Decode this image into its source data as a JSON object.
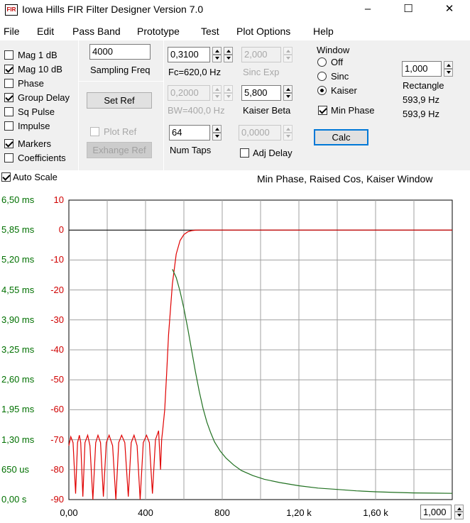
{
  "window": {
    "title": "Iowa Hills FIR Filter Designer  Version 7.0",
    "icon_text": "FIR",
    "controls": {
      "minimize": "–",
      "maximize": "☐",
      "close": "✕"
    }
  },
  "menu": [
    "File",
    "Edit",
    "Pass Band",
    "Prototype",
    "Test",
    "Plot Options",
    "Help"
  ],
  "options": [
    {
      "label": "Mag   1 dB",
      "checked": false
    },
    {
      "label": "Mag 10 dB",
      "checked": true
    },
    {
      "label": "Phase",
      "checked": false
    },
    {
      "label": "Group Delay",
      "checked": true
    },
    {
      "label": "Sq Pulse",
      "checked": false
    },
    {
      "label": "Impulse",
      "checked": false
    },
    {
      "label": "Markers",
      "checked": true
    },
    {
      "label": "Coefficients",
      "checked": false
    }
  ],
  "sampling": {
    "value": "4000",
    "label": "Sampling Freq"
  },
  "set_ref": "Set Ref",
  "plot_ref": {
    "label": "Plot Ref",
    "checked": false
  },
  "exchange_ref": "Exhange Ref",
  "fc": {
    "value": "0,3100",
    "label": "Fc=620,0 Hz"
  },
  "bw": {
    "value": "0,2000",
    "label": "BW=400,0 Hz"
  },
  "num_taps": {
    "value": "64",
    "label": "Num Taps"
  },
  "sinc_exp": {
    "value": "2,000",
    "label": "Sinc Exp"
  },
  "kaiser_beta": {
    "value": "5,800",
    "label": "Kaiser Beta"
  },
  "adj_delay": {
    "value": "0,0000",
    "label": "Adj Delay",
    "checked": false
  },
  "window_group": {
    "title": "Window",
    "options": [
      {
        "label": "Off",
        "selected": false
      },
      {
        "label": "Sinc",
        "selected": false
      },
      {
        "label": "Kaiser",
        "selected": true
      }
    ]
  },
  "min_phase": {
    "label": "Min Phase",
    "checked": true
  },
  "calc": "Calc",
  "rectangle": {
    "value": "1,000",
    "label": "Rectangle",
    "freq1": "593,9 Hz",
    "freq2": "593,9 Hz"
  },
  "auto_scale": {
    "label": "Auto Scale",
    "checked": true
  },
  "plot_title": "Min Phase, Raised Cos, Kaiser Window",
  "x_zoom": "1,000",
  "chart_data": {
    "type": "line",
    "title": "Min Phase, Raised Cos, Kaiser Window",
    "xlabel": "",
    "ylabel": "",
    "x_ticks": [
      "0,00",
      "400",
      "800",
      "1,20 k",
      "1,60 k"
    ],
    "x_range": [
      0,
      2000
    ],
    "y_left_ticks": [
      "6,50 ms",
      "5,85 ms",
      "5,20 ms",
      "4,55 ms",
      "3,90 ms",
      "3,25 ms",
      "2,60 ms",
      "1,95 ms",
      "1,30 ms",
      "650 us",
      "0,00 s"
    ],
    "y_right_ticks": [
      "10",
      "0",
      "-10",
      "-20",
      "-30",
      "-40",
      "-50",
      "-60",
      "-70",
      "-80",
      "-90"
    ],
    "db_range": [
      -90,
      10
    ],
    "delay_range_ms": [
      0,
      6.5
    ],
    "grid": true,
    "series": [
      {
        "color": "#e00000",
        "axis": "dB",
        "x": [
          0,
          10,
          22,
          35,
          45,
          55,
          62,
          73,
          84,
          98,
          110,
          125,
          140,
          152,
          165,
          180,
          195,
          210,
          228,
          245,
          260,
          275,
          292,
          310,
          325,
          340,
          356,
          372,
          388,
          405,
          420,
          436,
          452,
          468,
          478,
          484,
          490,
          500,
          510,
          520,
          540,
          560,
          580,
          600,
          620,
          640,
          660,
          680,
          700,
          720,
          760,
          2000
        ],
        "y": [
          -72,
          -69,
          -71,
          -88,
          -71,
          -68.5,
          -71,
          -89,
          -71,
          -68.5,
          -72,
          -90,
          -71,
          -68.5,
          -71,
          -89,
          -71,
          -68.5,
          -72,
          -90,
          -71,
          -68.5,
          -71,
          -89,
          -71,
          -68.5,
          -72,
          -90,
          -71,
          -68.5,
          -71,
          -88,
          -70,
          -67,
          -80,
          -70,
          -66.5,
          -60,
          -48,
          -35,
          -18,
          -8,
          -3.5,
          -1.5,
          -0.6,
          -0.2,
          -0.05,
          0,
          0,
          0,
          0,
          0
        ]
      },
      {
        "color": "#207020",
        "axis": "delay",
        "x": [
          540,
          560,
          580,
          600,
          620,
          640,
          660,
          680,
          700,
          720,
          740,
          760,
          790,
          820,
          860,
          900,
          960,
          1020,
          1100,
          1200,
          1300,
          1400,
          1500,
          1600,
          1700,
          1800,
          1900,
          2000
        ],
        "y": [
          5.0,
          4.82,
          4.52,
          4.15,
          3.72,
          3.25,
          2.78,
          2.35,
          1.98,
          1.68,
          1.45,
          1.25,
          1.05,
          0.9,
          0.75,
          0.63,
          0.52,
          0.44,
          0.37,
          0.3,
          0.25,
          0.22,
          0.19,
          0.17,
          0.155,
          0.145,
          0.14,
          0.135
        ]
      }
    ]
  }
}
